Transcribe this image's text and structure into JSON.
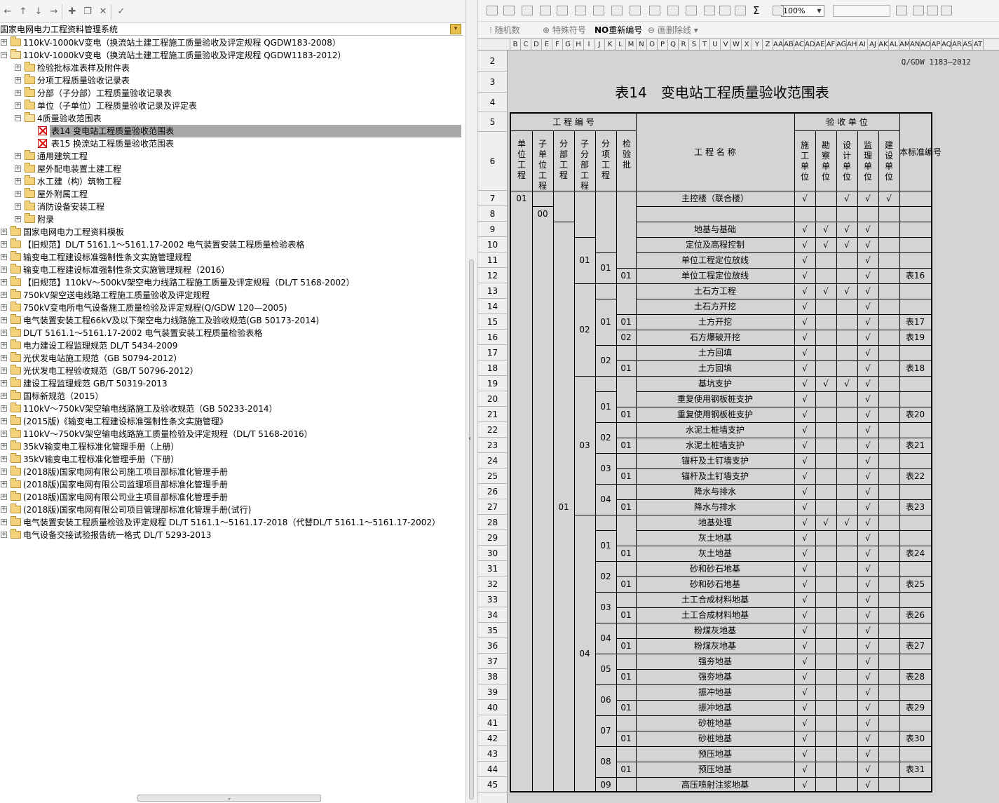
{
  "left_toolbar": {
    "buttons": [
      "back-icon",
      "up-icon",
      "down-icon",
      "forward-icon",
      "new-doc-icon",
      "copy-icon",
      "delete-icon",
      "check-icon"
    ]
  },
  "system_bar": {
    "title": "国家电网电力工程资料管理系统"
  },
  "tree": [
    {
      "level": 0,
      "label": "110kV-1000kV变电（换流站土建工程施工质量验收及评定规程 QGDW183-2008）",
      "expanded": false,
      "type": "folder"
    },
    {
      "level": 0,
      "label": "110kV-1000kV变电（换流站土建工程施工质量验收及评定规程 QGDW1183-2012）",
      "expanded": true,
      "type": "folder"
    },
    {
      "level": 1,
      "label": "检验批标准表样及附件表",
      "expanded": false,
      "type": "folder"
    },
    {
      "level": 1,
      "label": "分项工程质量验收记录表",
      "expanded": false,
      "type": "folder"
    },
    {
      "level": 1,
      "label": "分部（子分部）工程质量验收记录表",
      "expanded": false,
      "type": "folder"
    },
    {
      "level": 1,
      "label": "单位（子单位）工程质量验收记录及评定表",
      "expanded": false,
      "type": "folder"
    },
    {
      "level": 1,
      "label": "4质量验收范围表",
      "expanded": true,
      "type": "folder"
    },
    {
      "level": 2,
      "label": "表14 变电站工程质量验收范围表",
      "type": "sheet",
      "selected": true
    },
    {
      "level": 2,
      "label": "表15 换流站工程质量验收范围表",
      "type": "sheet"
    },
    {
      "level": 1,
      "label": "通用建筑工程",
      "expanded": false,
      "type": "folder"
    },
    {
      "level": 1,
      "label": "屋外配电装置土建工程",
      "expanded": false,
      "type": "folder"
    },
    {
      "level": 1,
      "label": "水工建（构）筑物工程",
      "expanded": false,
      "type": "folder"
    },
    {
      "level": 1,
      "label": "屋外附属工程",
      "expanded": false,
      "type": "folder"
    },
    {
      "level": 1,
      "label": "消防设备安装工程",
      "expanded": false,
      "type": "folder"
    },
    {
      "level": 1,
      "label": "附录",
      "expanded": false,
      "type": "folder"
    },
    {
      "level": 0,
      "label": "国家电网电力工程资料模板",
      "expanded": false,
      "type": "folder"
    },
    {
      "level": 0,
      "label": "【旧规范】DL/T 5161.1～5161.17-2002 电气装置安装工程质量检验表格",
      "expanded": false,
      "type": "folder"
    },
    {
      "level": 0,
      "label": "输变电工程建设标准强制性条文实施管理规程",
      "expanded": false,
      "type": "folder"
    },
    {
      "level": 0,
      "label": "输变电工程建设标准强制性条文实施管理规程（2016）",
      "expanded": false,
      "type": "folder"
    },
    {
      "level": 0,
      "label": "【旧规范】110kV～500kV架空电力线路工程施工质量及评定规程（DL/T 5168-2002）",
      "expanded": false,
      "type": "folder"
    },
    {
      "level": 0,
      "label": "750kV架空送电线路工程施工质量验收及评定规程",
      "expanded": false,
      "type": "folder"
    },
    {
      "level": 0,
      "label": "750kV变电所电气设备施工质量检验及评定规程(Q/GDW 120—2005)",
      "expanded": false,
      "type": "folder"
    },
    {
      "level": 0,
      "label": "电气装置安装工程66kV及以下架空电力线路施工及验收规范(GB 50173-2014)",
      "expanded": false,
      "type": "folder"
    },
    {
      "level": 0,
      "label": "DL/T 5161.1～5161.17-2002 电气装置安装工程质量检验表格",
      "expanded": false,
      "type": "folder"
    },
    {
      "level": 0,
      "label": "电力建设工程监理规范 DL/T 5434-2009",
      "expanded": false,
      "type": "folder"
    },
    {
      "level": 0,
      "label": "光伏发电站施工规范（GB 50794-2012）",
      "expanded": false,
      "type": "folder"
    },
    {
      "level": 0,
      "label": "光伏发电工程验收规范（GB/T 50796-2012）",
      "expanded": false,
      "type": "folder"
    },
    {
      "level": 0,
      "label": "建设工程监理规范 GB/T 50319-2013",
      "expanded": false,
      "type": "folder"
    },
    {
      "level": 0,
      "label": "国标新规范（2015）",
      "expanded": false,
      "type": "folder"
    },
    {
      "level": 0,
      "label": "110kV～750kV架空输电线路施工及验收规范（GB 50233-2014）",
      "expanded": false,
      "type": "folder"
    },
    {
      "level": 0,
      "label": "(2015版)《输变电工程建设标准强制性条文实施管理》",
      "expanded": false,
      "type": "folder"
    },
    {
      "level": 0,
      "label": "110kV～750kV架空输电线路施工质量检验及评定规程（DL/T 5168-2016）",
      "expanded": false,
      "type": "folder"
    },
    {
      "level": 0,
      "label": "35kV输变电工程标准化管理手册（上册）",
      "expanded": false,
      "type": "folder"
    },
    {
      "level": 0,
      "label": "35kV输变电工程标准化管理手册（下册）",
      "expanded": false,
      "type": "folder"
    },
    {
      "level": 0,
      "label": "(2018版)国家电网有限公司施工项目部标准化管理手册",
      "expanded": false,
      "type": "folder"
    },
    {
      "level": 0,
      "label": "(2018版)国家电网有限公司监理项目部标准化管理手册",
      "expanded": false,
      "type": "folder"
    },
    {
      "level": 0,
      "label": "(2018版)国家电网有限公司业主项目部标准化管理手册",
      "expanded": false,
      "type": "folder"
    },
    {
      "level": 0,
      "label": "(2018版)国家电网有限公司项目管理部标准化管理手册(试行)",
      "expanded": false,
      "type": "folder"
    },
    {
      "level": 0,
      "label": "电气装置安装工程质量检验及评定规程 DL/T 5161.1～5161.17-2018（代替DL/T 5161.1～5161.17-2002）",
      "expanded": false,
      "type": "folder"
    },
    {
      "level": 0,
      "label": "电气设备交接试验报告统一格式 DL/T 5293-2013",
      "expanded": false,
      "type": "folder"
    }
  ],
  "right_toolbar": {
    "zoom": "100%",
    "sigma": "Σ"
  },
  "right_toolbar2": {
    "random": "随机数",
    "special": "特殊符号",
    "renumber_prefix": "NO",
    "renumber": "重新编号",
    "delete_line": "画删除线"
  },
  "columns": [
    "B",
    "C",
    "D",
    "E",
    "F",
    "G",
    "H",
    "I",
    "J",
    "K",
    "L",
    "M",
    "N",
    "O",
    "P",
    "Q",
    "R",
    "S",
    "T",
    "U",
    "V",
    "W",
    "X",
    "Y",
    "Z",
    "AA",
    "AB",
    "AC",
    "AD",
    "AE",
    "AF",
    "AG",
    "AH",
    "AI",
    "AJ",
    "AK",
    "AL",
    "AM",
    "AN",
    "AO",
    "AP",
    "AQ",
    "AR",
    "AS",
    "AT"
  ],
  "row_numbers": [
    "2",
    "3",
    "4",
    "5",
    "6",
    "7",
    "8",
    "9",
    "10",
    "11",
    "12",
    "13",
    "14",
    "15",
    "16",
    "17",
    "18",
    "19",
    "20",
    "21",
    "22",
    "23",
    "24",
    "25",
    "26",
    "27",
    "28",
    "29",
    "30",
    "31",
    "32",
    "33",
    "34",
    "35",
    "36",
    "37",
    "38",
    "39",
    "40",
    "41",
    "42",
    "43",
    "44",
    "45"
  ],
  "document": {
    "standard_no": "Q/GDW 1183—2012",
    "title": "表14　变电站工程质量验收范围表",
    "header": {
      "group_code": "工 程 编 号",
      "group_accept": "验 收 单 位",
      "name": "工 程 名 称",
      "std": "本标准编号",
      "code_cols": [
        "单位工程",
        "子单位工程",
        "分部工程",
        "子分部工程",
        "分项工程",
        "检验批"
      ],
      "accept_cols": [
        "施工单位",
        "勘察单位",
        "设计单位",
        "监理单位",
        "建设单位"
      ]
    },
    "check": "√",
    "rows": [
      {
        "name": "主控楼（联合楼）",
        "c": [
          1,
          0,
          1,
          1,
          1
        ],
        "std": ""
      },
      {
        "name": "",
        "c": [
          0,
          0,
          0,
          0,
          0
        ],
        "std": ""
      },
      {
        "name": "地基与基础",
        "c": [
          1,
          1,
          1,
          1,
          0
        ],
        "std": ""
      },
      {
        "name": "定位及高程控制",
        "c": [
          1,
          1,
          1,
          1,
          0
        ],
        "std": ""
      },
      {
        "name": "单位工程定位放线",
        "c": [
          1,
          0,
          0,
          1,
          0
        ],
        "std": ""
      },
      {
        "name": "单位工程定位放线",
        "c": [
          1,
          0,
          0,
          1,
          0
        ],
        "std": "表16"
      },
      {
        "name": "土石方工程",
        "c": [
          1,
          1,
          1,
          1,
          0
        ],
        "std": ""
      },
      {
        "name": "土石方开挖",
        "c": [
          1,
          0,
          0,
          1,
          0
        ],
        "std": ""
      },
      {
        "name": "土方开挖",
        "c": [
          1,
          0,
          0,
          1,
          0
        ],
        "std": "表17"
      },
      {
        "name": "石方爆破开挖",
        "c": [
          1,
          0,
          0,
          1,
          0
        ],
        "std": "表19"
      },
      {
        "name": "土方回填",
        "c": [
          1,
          0,
          0,
          1,
          0
        ],
        "std": ""
      },
      {
        "name": "土方回填",
        "c": [
          1,
          0,
          0,
          1,
          0
        ],
        "std": "表18"
      },
      {
        "name": "基坑支护",
        "c": [
          1,
          1,
          1,
          1,
          0
        ],
        "std": ""
      },
      {
        "name": "重复使用钢板桩支护",
        "c": [
          1,
          0,
          0,
          1,
          0
        ],
        "std": ""
      },
      {
        "name": "重复使用钢板桩支护",
        "c": [
          1,
          0,
          0,
          1,
          0
        ],
        "std": "表20"
      },
      {
        "name": "水泥土桩墙支护",
        "c": [
          1,
          0,
          0,
          1,
          0
        ],
        "std": ""
      },
      {
        "name": "水泥土桩墙支护",
        "c": [
          1,
          0,
          0,
          1,
          0
        ],
        "std": "表21"
      },
      {
        "name": "锚杆及土钉墙支护",
        "c": [
          1,
          0,
          0,
          1,
          0
        ],
        "std": ""
      },
      {
        "name": "锚杆及土钉墙支护",
        "c": [
          1,
          0,
          0,
          1,
          0
        ],
        "std": "表22"
      },
      {
        "name": "降水与排水",
        "c": [
          1,
          0,
          0,
          1,
          0
        ],
        "std": ""
      },
      {
        "name": "降水与排水",
        "c": [
          1,
          0,
          0,
          1,
          0
        ],
        "std": "表23"
      },
      {
        "name": "地基处理",
        "c": [
          1,
          1,
          1,
          1,
          0
        ],
        "std": ""
      },
      {
        "name": "灰土地基",
        "c": [
          1,
          0,
          0,
          1,
          0
        ],
        "std": ""
      },
      {
        "name": "灰土地基",
        "c": [
          1,
          0,
          0,
          1,
          0
        ],
        "std": "表24"
      },
      {
        "name": "砂和砂石地基",
        "c": [
          1,
          0,
          0,
          1,
          0
        ],
        "std": ""
      },
      {
        "name": "砂和砂石地基",
        "c": [
          1,
          0,
          0,
          1,
          0
        ],
        "std": "表25"
      },
      {
        "name": "土工合成材料地基",
        "c": [
          1,
          0,
          0,
          1,
          0
        ],
        "std": ""
      },
      {
        "name": "土工合成材料地基",
        "c": [
          1,
          0,
          0,
          1,
          0
        ],
        "std": "表26"
      },
      {
        "name": "粉煤灰地基",
        "c": [
          1,
          0,
          0,
          1,
          0
        ],
        "std": ""
      },
      {
        "name": "粉煤灰地基",
        "c": [
          1,
          0,
          0,
          1,
          0
        ],
        "std": "表27"
      },
      {
        "name": "强夯地基",
        "c": [
          1,
          0,
          0,
          1,
          0
        ],
        "std": ""
      },
      {
        "name": "强夯地基",
        "c": [
          1,
          0,
          0,
          1,
          0
        ],
        "std": "表28"
      },
      {
        "name": "振冲地基",
        "c": [
          1,
          0,
          0,
          1,
          0
        ],
        "std": ""
      },
      {
        "name": "振冲地基",
        "c": [
          1,
          0,
          0,
          1,
          0
        ],
        "std": "表29"
      },
      {
        "name": "砂桩地基",
        "c": [
          1,
          0,
          0,
          1,
          0
        ],
        "std": ""
      },
      {
        "name": "砂桩地基",
        "c": [
          1,
          0,
          0,
          1,
          0
        ],
        "std": "表30"
      },
      {
        "name": "预压地基",
        "c": [
          1,
          0,
          0,
          1,
          0
        ],
        "std": ""
      },
      {
        "name": "预压地基",
        "c": [
          1,
          0,
          0,
          1,
          0
        ],
        "std": "表31"
      },
      {
        "name": "高压喷射注浆地基",
        "c": [
          1,
          0,
          0,
          1,
          0
        ],
        "std": ""
      }
    ],
    "codes": [
      {
        "col": 0,
        "start": 0,
        "span": 39,
        "text": "01"
      },
      {
        "col": 1,
        "start": 1,
        "span": 38,
        "text": "00"
      },
      {
        "col": 2,
        "start": 2,
        "span": 37,
        "text": "01"
      },
      {
        "col": 3,
        "start": 3,
        "span": 3,
        "text": "01"
      },
      {
        "col": 3,
        "start": 6,
        "span": 6,
        "text": "02"
      },
      {
        "col": 3,
        "start": 12,
        "span": 9,
        "text": "03"
      },
      {
        "col": 3,
        "start": 21,
        "span": 18,
        "text": "04"
      },
      {
        "col": 4,
        "start": 4,
        "span": 2,
        "text": "01"
      },
      {
        "col": 4,
        "start": 7,
        "span": 3,
        "text": "01"
      },
      {
        "col": 4,
        "start": 10,
        "span": 2,
        "text": "02"
      },
      {
        "col": 4,
        "start": 13,
        "span": 2,
        "text": "01"
      },
      {
        "col": 4,
        "start": 15,
        "span": 2,
        "text": "02"
      },
      {
        "col": 4,
        "start": 17,
        "span": 2,
        "text": "03"
      },
      {
        "col": 4,
        "start": 19,
        "span": 2,
        "text": "04"
      },
      {
        "col": 4,
        "start": 22,
        "span": 2,
        "text": "01"
      },
      {
        "col": 4,
        "start": 24,
        "span": 2,
        "text": "02"
      },
      {
        "col": 4,
        "start": 26,
        "span": 2,
        "text": "03"
      },
      {
        "col": 4,
        "start": 28,
        "span": 2,
        "text": "04"
      },
      {
        "col": 4,
        "start": 30,
        "span": 2,
        "text": "05"
      },
      {
        "col": 4,
        "start": 32,
        "span": 2,
        "text": "06"
      },
      {
        "col": 4,
        "start": 34,
        "span": 2,
        "text": "07"
      },
      {
        "col": 4,
        "start": 36,
        "span": 2,
        "text": "08"
      },
      {
        "col": 4,
        "start": 38,
        "span": 1,
        "text": "09"
      },
      {
        "col": 5,
        "start": 5,
        "span": 1,
        "text": "01"
      },
      {
        "col": 5,
        "start": 8,
        "span": 1,
        "text": "01"
      },
      {
        "col": 5,
        "start": 9,
        "span": 1,
        "text": "02"
      },
      {
        "col": 5,
        "start": 11,
        "span": 1,
        "text": "01"
      },
      {
        "col": 5,
        "start": 14,
        "span": 1,
        "text": "01"
      },
      {
        "col": 5,
        "start": 16,
        "span": 1,
        "text": "01"
      },
      {
        "col": 5,
        "start": 18,
        "span": 1,
        "text": "01"
      },
      {
        "col": 5,
        "start": 20,
        "span": 1,
        "text": "01"
      },
      {
        "col": 5,
        "start": 23,
        "span": 1,
        "text": "01"
      },
      {
        "col": 5,
        "start": 25,
        "span": 1,
        "text": "01"
      },
      {
        "col": 5,
        "start": 27,
        "span": 1,
        "text": "01"
      },
      {
        "col": 5,
        "start": 29,
        "span": 1,
        "text": "01"
      },
      {
        "col": 5,
        "start": 31,
        "span": 1,
        "text": "01"
      },
      {
        "col": 5,
        "start": 33,
        "span": 1,
        "text": "01"
      },
      {
        "col": 5,
        "start": 35,
        "span": 1,
        "text": "01"
      },
      {
        "col": 5,
        "start": 37,
        "span": 1,
        "text": "01"
      }
    ]
  }
}
